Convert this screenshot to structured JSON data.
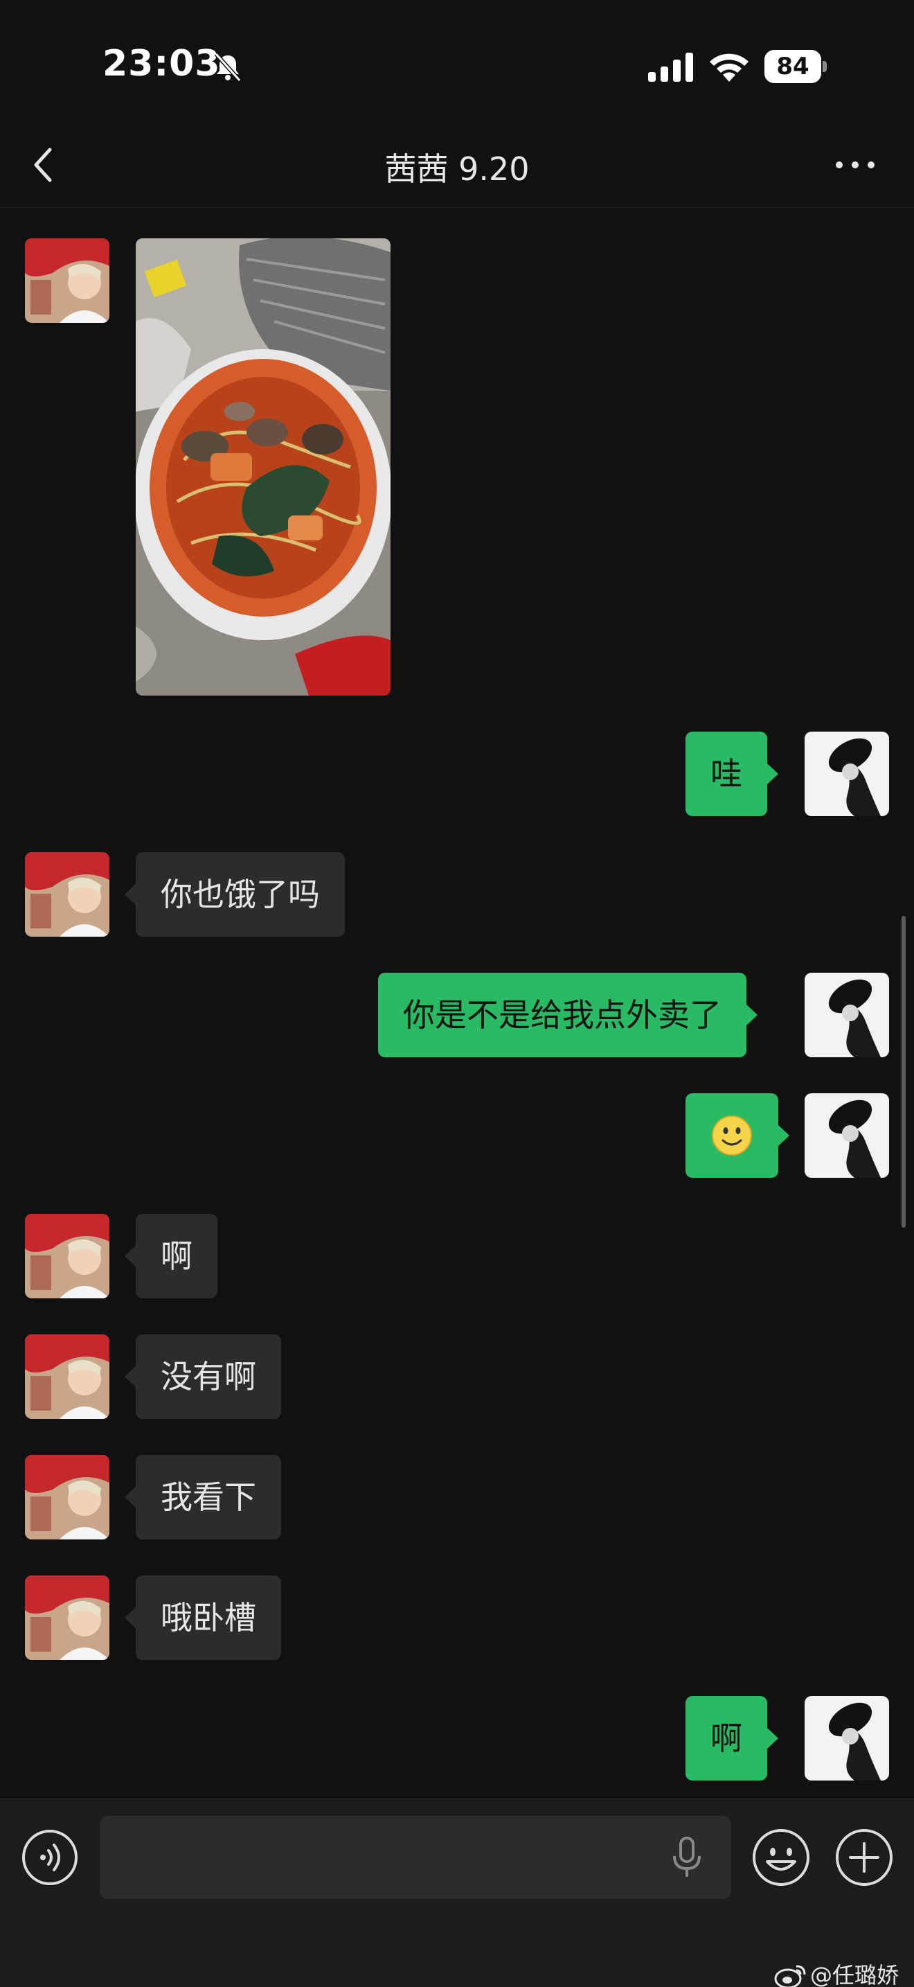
{
  "status_bar": {
    "time": "23:03",
    "battery": "84",
    "icons": [
      "bell-slash-icon",
      "cellular-signal-icon",
      "wifi-icon",
      "battery-icon"
    ]
  },
  "nav": {
    "title": "茜茜 9.20",
    "back_icon": "chevron-left-icon",
    "more_icon": "more-dots-icon"
  },
  "messages": [
    {
      "side": "in",
      "type": "image",
      "content": "photo of noodle soup in takeout bowl"
    },
    {
      "side": "out",
      "type": "text",
      "text": "哇"
    },
    {
      "side": "in",
      "type": "text",
      "text": "你也饿了吗"
    },
    {
      "side": "out",
      "type": "text",
      "text": "你是不是给我点外卖了"
    },
    {
      "side": "out",
      "type": "emoji",
      "text": "🙂"
    },
    {
      "side": "in",
      "type": "text",
      "text": "啊"
    },
    {
      "side": "in",
      "type": "text",
      "text": "没有啊"
    },
    {
      "side": "in",
      "type": "text",
      "text": "我看下"
    },
    {
      "side": "in",
      "type": "text",
      "text": "哦卧槽"
    },
    {
      "side": "out",
      "type": "text",
      "text": "啊"
    }
  ],
  "input_bar": {
    "placeholder": "",
    "icons": [
      "voice-icon",
      "microphone-icon",
      "emoji-icon",
      "add-icon"
    ]
  },
  "watermark": "@任璐娇",
  "colors": {
    "background": "#111111",
    "bubble_out": "#29bb64",
    "bubble_in": "#2c2c2c"
  }
}
